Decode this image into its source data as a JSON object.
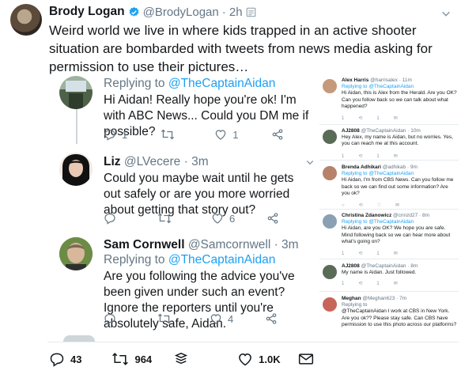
{
  "tweet": {
    "author_name": "Brody Logan",
    "handle": "@BrodyLogan",
    "time": "· 2h",
    "text": "Weird world we live in where kids trapped in an active shooter situation are bombarded with tweets from news media asking for permission to use their pictures…",
    "stats": {
      "replies": "43",
      "retweets": "964",
      "likes": "1.0K"
    }
  },
  "replies": [
    {
      "replying_prefix": "Replying to ",
      "replying_handle": "@TheCaptainAidan",
      "text": "Hi Aidan! Really hope you're ok! I'm with ABC News... Could you DM me if possible?",
      "reply_count": "1",
      "like_count": "1"
    },
    {
      "name": "Liz",
      "handle": "@LVecere",
      "time": "· 3m",
      "text": "Could you maybe wait until he gets out safely or are you more worried about getting that story out?",
      "like_count": "6"
    },
    {
      "name": "Sam Cornwell",
      "handle": "@Samcornwell",
      "time": "· 3m",
      "replying_prefix": "Replying to ",
      "replying_handle": "@TheCaptainAidan",
      "text": "Are you following the advice you've been given under such an event? Ignore the reporters until you're absolutely safe, Aidan.",
      "like_count": "4"
    }
  ],
  "mini_tweets": [
    {
      "name": "Alex Harris",
      "handle": "@harrisalex · 11m",
      "replying": "Replying to @TheCaptainAidan",
      "text": "Hi Aidan, this is Alex from the Herald. Are you OK? Can you follow back so we can talk about what happened?",
      "counts": [
        "1",
        "",
        "1",
        ""
      ]
    },
    {
      "name": "AJ2808",
      "handle": "@TheCaptainAidan · 10m",
      "replying": "",
      "text": "Hey Alex, my name is Aidan, but no worries. Yes, you can reach me at this account.",
      "counts": [
        "1",
        "",
        "1",
        ""
      ]
    },
    {
      "name": "Brenda Adhikari",
      "handle": "@adhikab · 9m",
      "replying": "Replying to @TheCaptainAidan",
      "text": "Hi Aidan, I'm from CBS News. Can you follow me back so we can find out some information? Are you ok?",
      "counts": [
        "",
        "",
        "",
        ""
      ]
    },
    {
      "name": "Christina Zdanowicz",
      "handle": "@cnnzd27 · 8m",
      "replying": "Replying to @TheCaptainAidan",
      "text": "Hi Aidan, are you OK? We hope you are safe. Mind following back so we can hear more about what's going on?",
      "counts": [
        "1",
        "",
        "1",
        ""
      ]
    },
    {
      "name": "AJ2808",
      "handle": "@TheCaptainAidan · 8m",
      "replying": "",
      "text": "My name is Aidan. Just followed.",
      "counts": [
        "1",
        "",
        "1",
        ""
      ]
    },
    {
      "name": "Meghan",
      "handle": "@Meghan623 · 7m",
      "replying": "Replying to",
      "text": "@TheCaptainAidan I work at CBS in New York. Are you ok?? Please stay safe. Can CBS have permission to use this photo across our platforms?",
      "counts": [
        "",
        "",
        "",
        ""
      ]
    }
  ],
  "colors": {
    "accent": "#1da1f2",
    "muted": "#657786",
    "text": "#14171a"
  },
  "icons": [
    "verified-icon",
    "chevron-down-icon",
    "reply-icon",
    "retweet-icon",
    "like-icon",
    "share-icon",
    "dm-icon",
    "envelope-icon"
  ]
}
